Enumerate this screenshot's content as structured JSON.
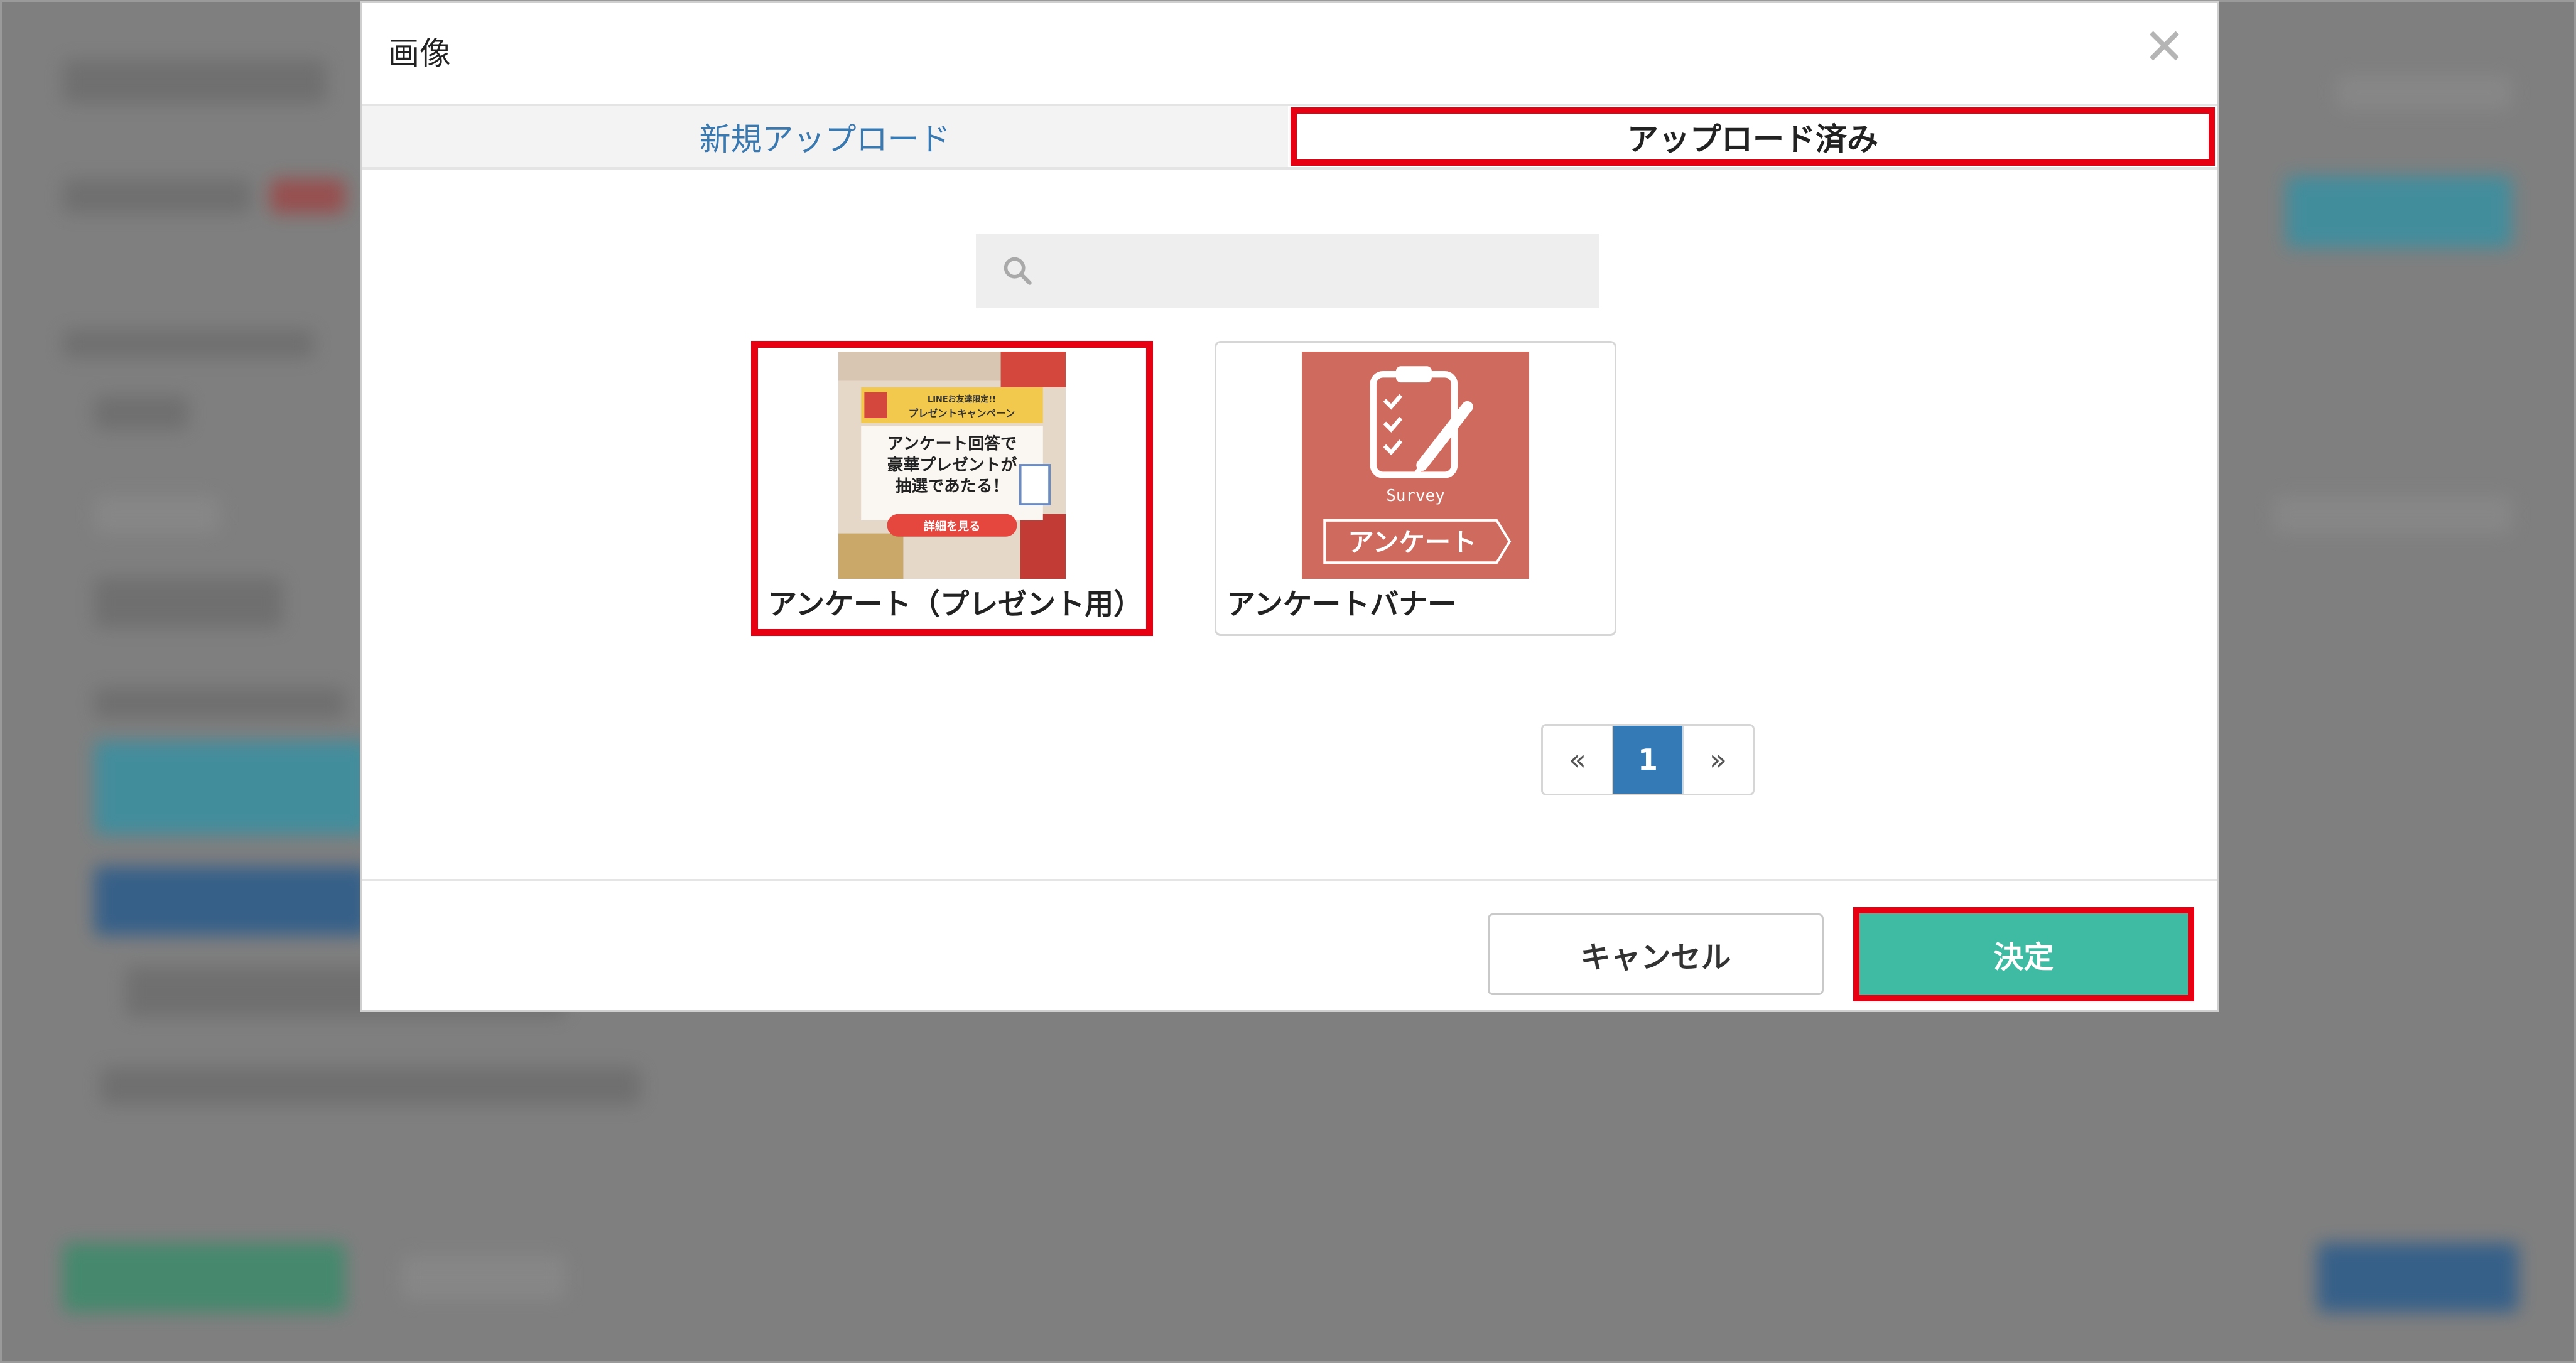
{
  "dialog": {
    "title": "画像"
  },
  "tabs": [
    {
      "label": "新規アップロード",
      "active": false
    },
    {
      "label": "アップロード済み",
      "active": true
    }
  ],
  "search": {
    "placeholder": "",
    "value": ""
  },
  "images": [
    {
      "label": "アンケート（プレゼント用）",
      "selected": true,
      "thumb_lines": [
        "LINEお友達限定!!",
        "プレゼントキャンペーン",
        "アンケート回答で",
        "豪華プレゼントが",
        "抽選であたる！",
        "詳細を見る"
      ]
    },
    {
      "label": "アンケートバナー",
      "selected": false,
      "thumb_lines": [
        "Survey",
        "アンケート"
      ]
    }
  ],
  "pagination": {
    "prev": "«",
    "current": "1",
    "next": "»"
  },
  "footer": {
    "cancel_label": "キャンセル",
    "ok_label": "決定"
  },
  "colors": {
    "accent": "#337ab7",
    "primary_button": "#40bba3",
    "highlight": "#e60012",
    "banner": "#cf6b5e"
  }
}
